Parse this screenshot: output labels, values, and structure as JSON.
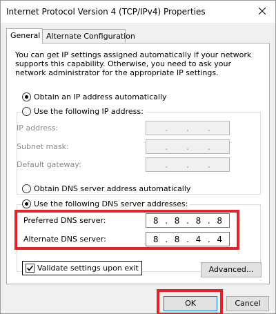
{
  "window": {
    "title": "Internet Protocol Version 4 (TCP/IPv4) Properties"
  },
  "tabs": [
    {
      "label": "General",
      "active": true
    },
    {
      "label": "Alternate Configuration",
      "active": false
    }
  ],
  "description": "You can get IP settings assigned automatically if your network supports this capability. Otherwise, you need to ask your network administrator for the appropriate IP settings.",
  "ip_settings": {
    "auto_label": "Obtain an IP address automatically",
    "auto_selected": true,
    "manual_label": "Use the following IP address:",
    "manual_selected": false,
    "fields": [
      {
        "label": "IP address:",
        "octets": [
          "",
          "",
          "",
          ""
        ]
      },
      {
        "label": "Subnet mask:",
        "octets": [
          "",
          "",
          "",
          ""
        ]
      },
      {
        "label": "Default gateway:",
        "octets": [
          "",
          "",
          "",
          ""
        ]
      }
    ]
  },
  "dns_settings": {
    "auto_label": "Obtain DNS server address automatically",
    "auto_selected": false,
    "manual_label": "Use the following DNS server addresses:",
    "manual_selected": true,
    "preferred": {
      "label": "Preferred DNS server:",
      "octets": [
        "8",
        "8",
        "8",
        "8"
      ]
    },
    "alternate": {
      "label": "Alternate DNS server:",
      "octets": [
        "8",
        "8",
        "4",
        "4"
      ]
    }
  },
  "validate": {
    "label": "Validate settings upon exit",
    "checked": true
  },
  "buttons": {
    "advanced": "Advanced...",
    "ok": "OK",
    "cancel": "Cancel"
  },
  "colors": {
    "highlight": "#e0242a",
    "window_bg": "#f0f0f0",
    "focus_border": "#0078d7"
  },
  "icons": {
    "close": "close-icon",
    "check": "checkmark-icon"
  }
}
